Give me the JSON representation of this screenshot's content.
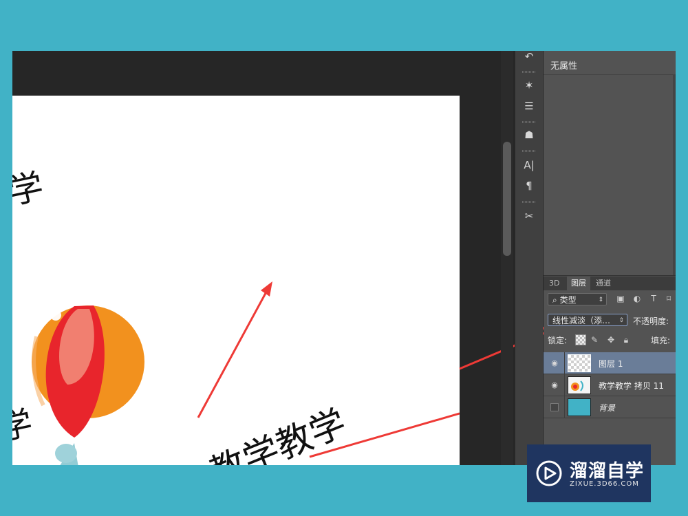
{
  "canvas": {
    "char_top_left": "学",
    "char_left_middle": "学",
    "text_bottom": "教学教学",
    "colors": {
      "ball_orange": "#f2911e",
      "ball_red": "#e8252c",
      "arrow": "#ee3a36"
    }
  },
  "tools": [
    {
      "icon": "history-icon",
      "glyph": "↶"
    },
    {
      "icon": "brush-presets-icon",
      "glyph": "✶"
    },
    {
      "icon": "adjust-icon",
      "glyph": "☰"
    },
    {
      "icon": "clone-source-icon",
      "glyph": "☗"
    },
    {
      "icon": "character-icon",
      "glyph": "A|"
    },
    {
      "icon": "paragraph-icon",
      "glyph": "¶"
    },
    {
      "icon": "tool-presets-icon",
      "glyph": "✂"
    }
  ],
  "properties": {
    "title": "无属性"
  },
  "layers_panel": {
    "tabs": [
      "3D",
      "图层",
      "通道"
    ],
    "active_tab": "图层",
    "filter_kind": "类型",
    "blend_mode": "线性减淡（添…",
    "opacity_label": "不透明度:",
    "lock_label": "锁定:",
    "fill_label": "填充:",
    "layers": [
      {
        "name": "图层 1",
        "visible": true,
        "selected": true
      },
      {
        "name": "教学教学 拷贝 11",
        "visible": true,
        "selected": false
      },
      {
        "name": "背景",
        "visible": false,
        "selected": false
      }
    ]
  },
  "watermark": {
    "title": "溜溜自学",
    "subtitle": "ZIXUE.3D66.COM"
  }
}
